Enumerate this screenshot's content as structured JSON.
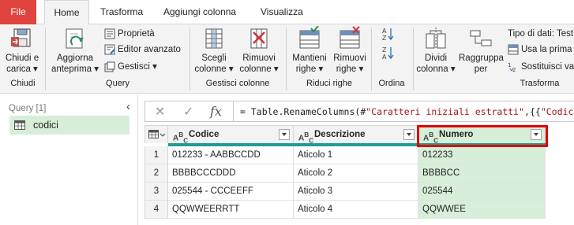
{
  "tabs": {
    "file": "File",
    "home": "Home",
    "trasforma": "Trasforma",
    "aggiungi": "Aggiungi colonna",
    "visualizza": "Visualizza"
  },
  "ribbon": {
    "chiudi": {
      "label1": "Chiudi e",
      "label2": "carica ▾",
      "group": "Chiudi"
    },
    "query": {
      "aggiorna1": "Aggiorna",
      "aggiorna2": "anteprima ▾",
      "proprieta": "Proprietà",
      "editor": "Editor avanzato",
      "gestisci": "Gestisci ▾",
      "group": "Query"
    },
    "gestisci_colonne": {
      "scegli1": "Scegli",
      "scegli2": "colonne ▾",
      "rimuovi1": "Rimuovi",
      "rimuovi2": "colonne ▾",
      "group": "Gestisci colonne"
    },
    "riduci_righe": {
      "mantieni1": "Mantieni",
      "mantieni2": "righe ▾",
      "rimuovi1": "Rimuovi",
      "rimuovi2": "righe ▾",
      "group": "Riduci righe"
    },
    "ordina": {
      "group": "Ordina"
    },
    "trasforma": {
      "dividi1": "Dividi",
      "dividi2": "colonna ▾",
      "raggruppa1": "Raggruppa",
      "raggruppa2": "per",
      "tipo_dati": "Tipo di dati: Test",
      "usa_prima": "Usa la prima",
      "sostituisci": "Sostituisci va",
      "group": "Trasforma"
    }
  },
  "queries_panel": {
    "header": "Query [1]",
    "items": [
      "codici"
    ]
  },
  "formula_bar": {
    "prefix": "= Table.RenameColumns(#",
    "string1": "\"Caratteri iniziali estratti\"",
    "mid": ",{{",
    "string2": "\"Codice -"
  },
  "table": {
    "columns": [
      "Codice",
      "Descrizione",
      "Numero"
    ],
    "type_icon": "ABC",
    "rows": [
      {
        "num": "1",
        "codice": "012233 - AABBCCDD",
        "descrizione": "Aticolo 1",
        "numero": "012233"
      },
      {
        "num": "2",
        "codice": "BBBBCCCDDD",
        "descrizione": "Aticolo 2",
        "numero": "BBBBCC"
      },
      {
        "num": "3",
        "codice": "025544 - CCCEEFF",
        "descrizione": "Aticolo 3",
        "numero": "025544"
      },
      {
        "num": "4",
        "codice": "QQWWEERRTT",
        "descrizione": "Aticolo 4",
        "numero": "QQWWEE"
      }
    ]
  },
  "colors": {
    "file_tab": "#e0443e",
    "selected_column": "#d7eed9",
    "column_quality_bar": "#1b9e8f",
    "highlight_box": "#e00000"
  }
}
